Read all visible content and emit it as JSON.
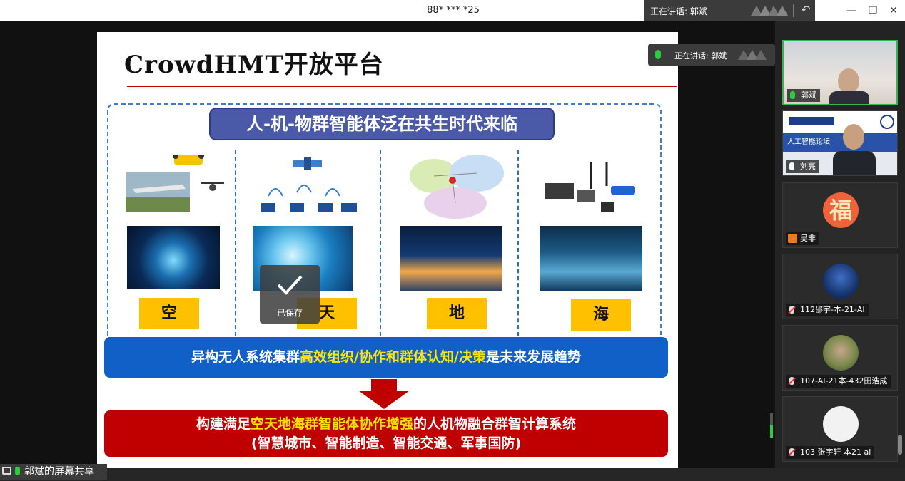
{
  "window": {
    "title": "88* *** *25",
    "speaking_label": "正在讲话: 郭斌",
    "minimize": "—",
    "maximize": "❐",
    "close": "✕"
  },
  "slide": {
    "title": "CrowdHMT开放平台",
    "banner": "人-机-物群智能体泛在共生时代来临",
    "labels": [
      "空",
      "天",
      "地",
      "海"
    ],
    "blue_bar": {
      "part1": "异构无人系统集群",
      "highlight": "高效组织/协作和群体认知/决策",
      "part2": "是未来发展趋势"
    },
    "red_bar": {
      "part1": "构建满足",
      "highlight": "空天地海群智能体协作增强",
      "part2": "的人机物融合群智计算系统",
      "line2": "(智慧城市、智能制造、智能交通、军事国防)"
    }
  },
  "overlay_speaking": "正在讲话: 郭斌",
  "saved_toast": "已保存",
  "share_tag": "郭斌的屏幕共享",
  "participants": [
    {
      "name": "郭斌",
      "mic": "active"
    },
    {
      "name": "刘亮",
      "mic": "on",
      "slide_text": "人工智能论坛"
    },
    {
      "name": "吴非",
      "mic": "none",
      "avatar_char": "福"
    },
    {
      "name": "112邵宇-本-21-AI",
      "mic": "muted"
    },
    {
      "name": "107-AI-21本-432田浩成",
      "mic": "muted"
    },
    {
      "name": "103 张宇轩 本21 ai",
      "mic": "muted"
    }
  ],
  "colors": {
    "accent_green": "#33b551",
    "slide_red": "#c00000",
    "slide_blue": "#1160c8",
    "label_yellow": "#ffc000"
  }
}
